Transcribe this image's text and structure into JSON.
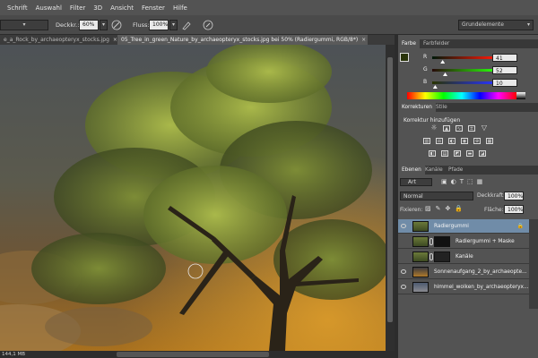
{
  "menu": [
    "Schrift",
    "Auswahl",
    "Filter",
    "3D",
    "Ansicht",
    "Fenster",
    "Hilfe"
  ],
  "options": {
    "opacity_label": "Deckkr.:",
    "opacity_value": "60%",
    "flow_label": "Fluss:",
    "flow_value": "100%",
    "workspace": "Grundelemente"
  },
  "tabs": [
    {
      "label": "e_a_Rock_by_archaeopteryx_stocks.jpg",
      "close": "×",
      "active": false
    },
    {
      "label": "05_Tree_in_green_Nature_by_archaeopteryx_stocks.jpg bei 50% (Radiergummi, RGB/8*)",
      "close": "×",
      "active": true
    }
  ],
  "status": {
    "doc_size": "144,1 MB"
  },
  "color_panel": {
    "tabs": [
      "Farbe",
      "Farbfelder"
    ],
    "channels": [
      {
        "label": "R",
        "value": "41",
        "fraction": 0.16,
        "gradient": "linear-gradient(90deg,#001a0a,#ff1a0a)"
      },
      {
        "label": "G",
        "value": "52",
        "fraction": 0.2,
        "gradient": "linear-gradient(90deg,#290a0a,#29ff0a)"
      },
      {
        "label": "B",
        "value": "10",
        "fraction": 0.04,
        "gradient": "linear-gradient(90deg,#293400,#2934ff)"
      }
    ],
    "foreground": "#29340a"
  },
  "adjust_panel": {
    "tabs": [
      "Korrekturen",
      "Stile"
    ],
    "title": "Korrektur hinzufügen"
  },
  "layers_panel": {
    "tabs": [
      "Ebenen",
      "Kanäle",
      "Pfade"
    ],
    "filter": "Art",
    "blend_mode": "Normal",
    "opacity_label": "Deckkraft:",
    "opacity_value": "100%",
    "lock_label": "Fixieren:",
    "fill_label": "Fläche:",
    "fill_value": "100%",
    "layers": [
      {
        "name": "Radiergummi",
        "selected": true,
        "visible": true,
        "has_mask": true,
        "locked": true
      },
      {
        "name": "Radiergummi + Maske",
        "selected": false,
        "visible": false,
        "has_mask": true,
        "locked": false
      },
      {
        "name": "Kanäle",
        "selected": false,
        "visible": false,
        "has_mask": true,
        "locked": false
      },
      {
        "name": "Sonnenaufgang_2_by_archaeopte...",
        "selected": false,
        "visible": true,
        "has_mask": false,
        "locked": false
      },
      {
        "name": "himmel_wolken_by_archaeopteryx...",
        "selected": false,
        "visible": true,
        "has_mask": false,
        "locked": false
      }
    ]
  }
}
